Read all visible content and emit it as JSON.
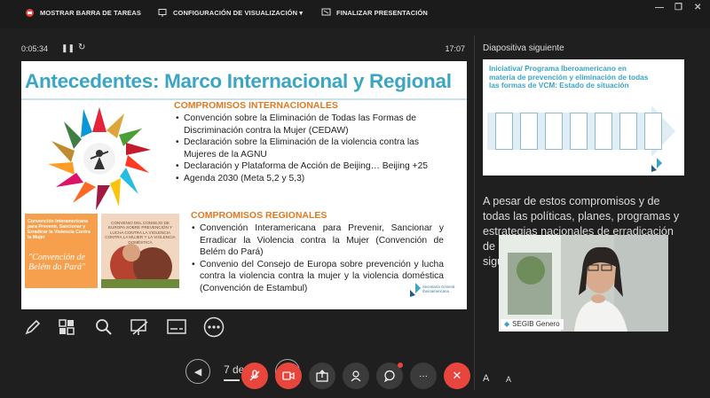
{
  "toolbar": {
    "show_taskbar": "MOSTRAR BARRA DE TAREAS",
    "display_settings": "CONFIGURACIÓN DE VISUALIZACIÓN ▾",
    "end_presentation": "FINALIZAR PRESENTACIÓN"
  },
  "timer": {
    "elapsed": "0:05:34",
    "clock": "17:07"
  },
  "slide": {
    "title": "Antecedentes: Marco Internacional y Regional",
    "intl_heading": "COMPROMISOS INTERNACIONALES",
    "intl_items": [
      "Convención sobre la Eliminación de Todas las Formas de Discriminación contra la Mujer (CEDAW)",
      "Declaración sobre la Eliminación de la violencia contra las Mujeres de la AGNU",
      "Declaración y Plataforma de Acción de Beijing… Beijing +25",
      "Agenda 2030 (Meta 5,2 y 5,3)"
    ],
    "regional_heading": "COMPROMISOS REGIONALES",
    "regional_items": [
      "Convención Interamericana para Prevenir, Sancionar y Erradicar la Violencia contra la Mujer (Convención de Belém do Pará)",
      "Convenio del Consejo de Europa sobre prevención y lucha contra la violencia contra la mujer y la violencia doméstica (Convención de Estambul)"
    ],
    "orange_small": "Convención Interamericana para Prevenir, Sancionar y Erradicar la Violencia Contra la Mujer",
    "orange_big": "\"Convención de Belém do Pará\"",
    "photo_text": "CONVENIO DEL CONSEJO DE EUROPA SOBRE PREVENCIÓN Y LUCHA CONTRA LA VIOLENCIA CONTRA LA MUJER Y LA VIOLENCIA DOMÉSTICA",
    "logo_text": "Secretaría General Iberoamericana"
  },
  "bottom": {
    "slide_counter": "7 de"
  },
  "next_slide": {
    "label": "Diapositiva siguiente",
    "title": "Iniciativa/ Programa Iberoamericano en materia de prevención y eliminación de todas las formas de VCM: Estado de situación"
  },
  "notes": {
    "text": "A pesar de estos compromisos y de todas las políticas, planes, programas y estrategias nacionales de erradicación de la violencia contra las mujeres, se sigue en los países …"
  },
  "video": {
    "name": "SEGIB Genero"
  },
  "font_controls": {
    "increase": "A",
    "decrease": "A"
  },
  "colors": {
    "accent": "#3aa6c4",
    "orange": "#e07a22",
    "hangup": "#e8453c"
  }
}
